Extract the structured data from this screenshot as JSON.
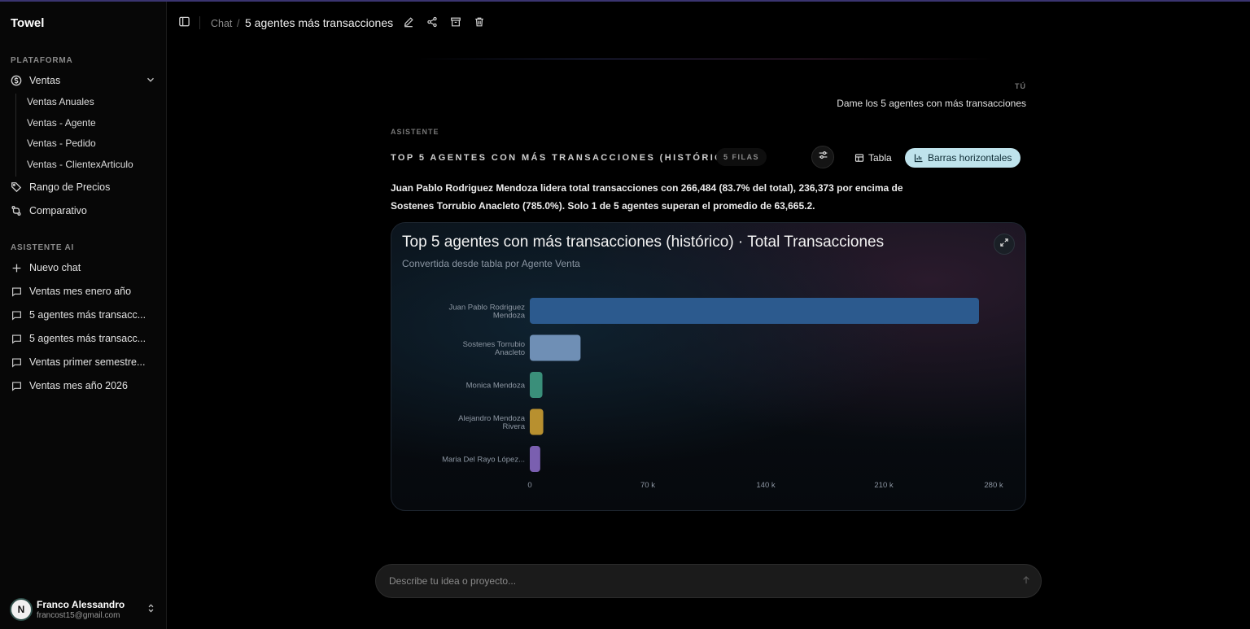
{
  "sidebar": {
    "brand": "Towel",
    "platform_label": "PLATAFORMA",
    "nav": [
      {
        "label": "Ventas",
        "icon": "dollar-circle-icon"
      },
      {
        "label": "Rango de Precios",
        "icon": "tag-icon"
      },
      {
        "label": "Comparativo",
        "icon": "compare-arrows-icon"
      }
    ],
    "ventas_sub": [
      "Ventas Anuales",
      "Ventas - Agente",
      "Ventas - Pedido",
      "Ventas - ClientexArticulo"
    ],
    "ai_label": "ASISTENTE AI",
    "new_chat": "Nuevo chat",
    "chats": [
      "Ventas mes enero año",
      "5 agentes más transacc...",
      "5 agentes más transacc...",
      "Ventas primer semestre...",
      "Ventas mes año 2026"
    ],
    "user": {
      "initial": "N",
      "name": "Franco Alessandro",
      "email": "francost15@gmail.com"
    }
  },
  "header": {
    "crumb_root": "Chat",
    "crumb_sep": "/",
    "title": "5 agentes más transacciones"
  },
  "conversation": {
    "you_label": "TÚ",
    "user_message": "Dame los 5 agentes con más transacciones",
    "assistant_label": "ASISTENTE",
    "result_title": "TOP 5 AGENTES CON MÁS TRANSACCIONES (HISTÓRICO)",
    "rows_badge": "5 FILAS",
    "view_table": "Tabla",
    "view_bars": "Barras horizontales",
    "summary": "Juan Pablo Rodriguez Mendoza lidera total transacciones con 266,484 (83.7% del total), 236,373 por encima de Sostenes Torrubio Anacleto (785.0%). Solo 1 de 5 agentes superan el promedio de 63,665.2."
  },
  "chart_data": {
    "type": "bar",
    "orientation": "horizontal",
    "title": "Top 5 agentes con más transacciones (histórico) · Total Transacciones",
    "subtitle": "Convertida desde tabla por Agente Venta",
    "categories": [
      "Juan Pablo Rodriguez Mendoza",
      "Sostenes Torrubio Anacleto",
      "Monica Mendoza",
      "Alejandro Mendoza Rivera",
      "Maria Del Rayo López..."
    ],
    "category_lines": [
      [
        "Juan Pablo Rodriguez",
        "Mendoza"
      ],
      [
        "Sostenes Torrubio",
        "Anacleto"
      ],
      [
        "Monica Mendoza"
      ],
      [
        "Alejandro Mendoza",
        "Rivera"
      ],
      [
        "Maria Del Rayo López..."
      ]
    ],
    "values": [
      266484,
      30111,
      7500,
      8000,
      6200
    ],
    "colors": [
      "#2c5a8e",
      "#6f8fb5",
      "#3a8f7a",
      "#b8902f",
      "#7a5fb0"
    ],
    "xlim": [
      0,
      280000
    ],
    "xticks": [
      0,
      70000,
      140000,
      210000,
      280000
    ],
    "xtick_labels": [
      "0",
      "70 k",
      "140 k",
      "210 k",
      "280 k"
    ],
    "grid": false,
    "legend": "none"
  },
  "input": {
    "placeholder": "Describe tu idea o proyecto..."
  }
}
